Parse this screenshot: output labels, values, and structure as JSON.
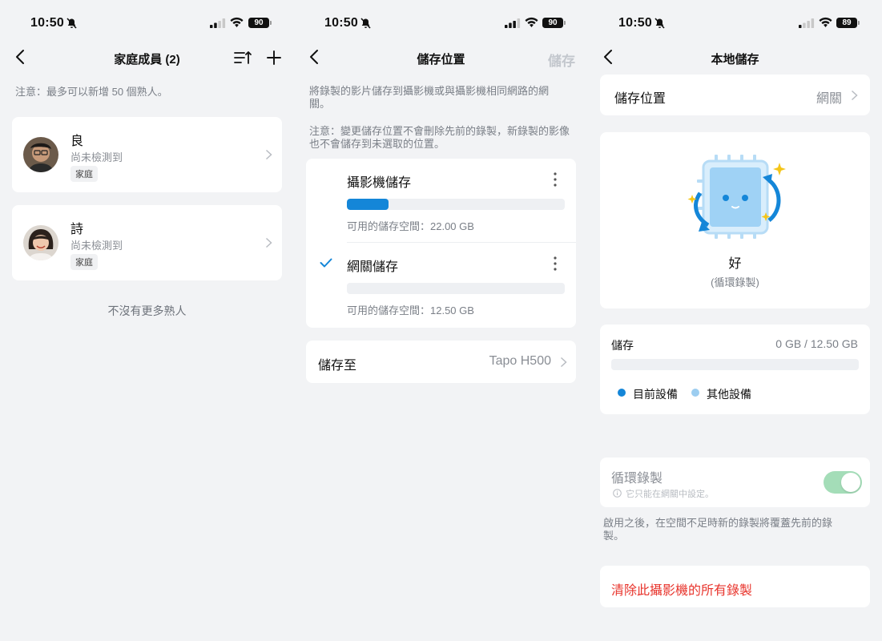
{
  "screen1": {
    "status": {
      "time": "10:50",
      "battery": "90"
    },
    "title": "家庭成員 (2)",
    "notice": "注意：最多可以新增 50 個熟人。",
    "members": [
      {
        "name": "良",
        "status": "尚未檢測到",
        "tag": "家庭"
      },
      {
        "name": "詩",
        "status": "尚未檢測到",
        "tag": "家庭"
      }
    ],
    "footer": "不沒有更多熟人"
  },
  "screen2": {
    "status": {
      "time": "10:50",
      "battery": "90"
    },
    "title": "儲存位置",
    "save_label": "儲存",
    "description": "將錄製的影片儲存到攝影機或與攝影機相同網路的網關。",
    "warning": "注意：變更儲存位置不會刪除先前的錄製，新錄製的影像也不會儲存到未選取的位置。",
    "options": [
      {
        "title": "攝影機儲存",
        "available": "可用的儲存空間：22.00 GB",
        "used_fraction": 0.19,
        "selected": false
      },
      {
        "title": "網關儲存",
        "available": "可用的儲存空間：12.50 GB",
        "used_fraction": 0.0,
        "selected": true
      }
    ],
    "save_to": {
      "label": "儲存至",
      "value": "Tapo H500"
    }
  },
  "screen3": {
    "status": {
      "time": "10:50",
      "battery": "89"
    },
    "title": "本地儲存",
    "location": {
      "label": "儲存位置",
      "value": "網關"
    },
    "health": {
      "status": "好",
      "mode": "(循環錄製)"
    },
    "storage": {
      "label": "儲存",
      "usage": "0 GB / 12.50 GB",
      "used_fraction": 0.0
    },
    "legend": [
      {
        "label": "目前設備",
        "color": "#1486d8"
      },
      {
        "label": "其他設備",
        "color": "#9ccdf0"
      }
    ],
    "loop": {
      "label": "循環錄製",
      "hint": "它只能在網關中設定。",
      "enabled": true
    },
    "loop_description": "啟用之後，在空間不足時新的錄製將覆蓋先前的錄製。",
    "clear_label": "清除此攝影機的所有錄製",
    "colors": {
      "accent": "#1486d8",
      "danger": "#e8342c",
      "toggle_on": "#a4ddb8"
    }
  }
}
